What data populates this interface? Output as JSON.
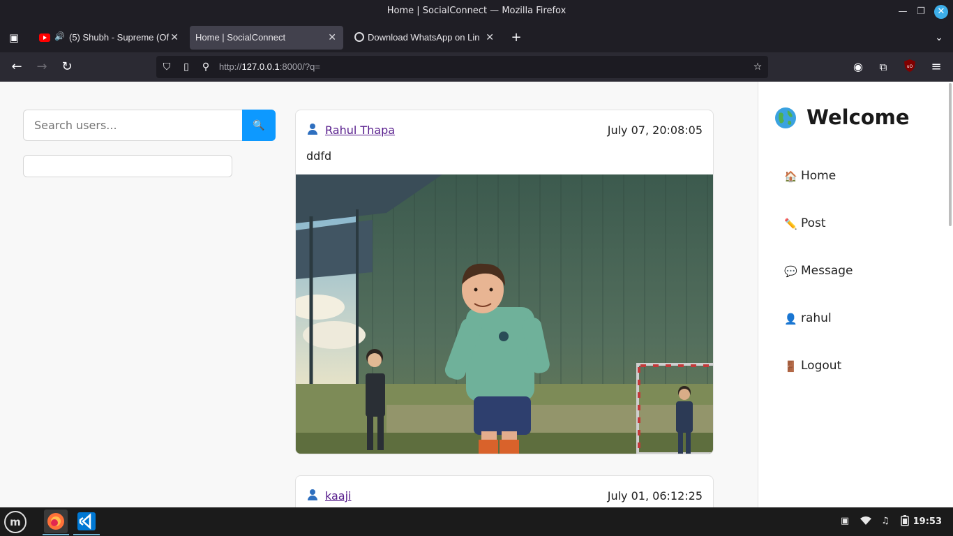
{
  "window": {
    "title": "Home | SocialConnect — Mozilla Firefox"
  },
  "tabs": [
    {
      "label": "(5) Shubh - Supreme (Of",
      "icon": "youtube-icon",
      "audio": true
    },
    {
      "label": "Home | SocialConnect",
      "active": true
    },
    {
      "label": "Download WhatsApp on Lin",
      "icon": "whatsapp-icon"
    }
  ],
  "address_bar": {
    "url_prefix": "http://",
    "url_host": "127.0.0.1",
    "url_rest": ":8000/?q="
  },
  "page": {
    "search": {
      "placeholder": "Search users...",
      "button_icon": "🔍"
    },
    "posts": [
      {
        "author_icon": "👤",
        "author": "Rahul Thapa",
        "timestamp": "July 07, 20:08:05",
        "text": "ddfd",
        "has_image": true
      },
      {
        "author_icon": "👤",
        "author": "kaaji",
        "timestamp": "July 01, 06:12:25"
      }
    ],
    "sidebar": {
      "welcome": "Welcome",
      "globe_icon": "🌐",
      "items": [
        {
          "emoji": "🏠",
          "label": "Home"
        },
        {
          "emoji": "✏️",
          "label": "Post"
        },
        {
          "emoji": "💬",
          "label": "Message"
        },
        {
          "emoji": "👤",
          "label": "rahul"
        },
        {
          "emoji": "🚪",
          "label": "Logout"
        }
      ]
    }
  },
  "taskbar": {
    "clock": "19:53",
    "apps": [
      "firefox-icon",
      "vscode-icon"
    ]
  },
  "colors": {
    "accent": "#0d99ff",
    "link": "#551a8b"
  }
}
